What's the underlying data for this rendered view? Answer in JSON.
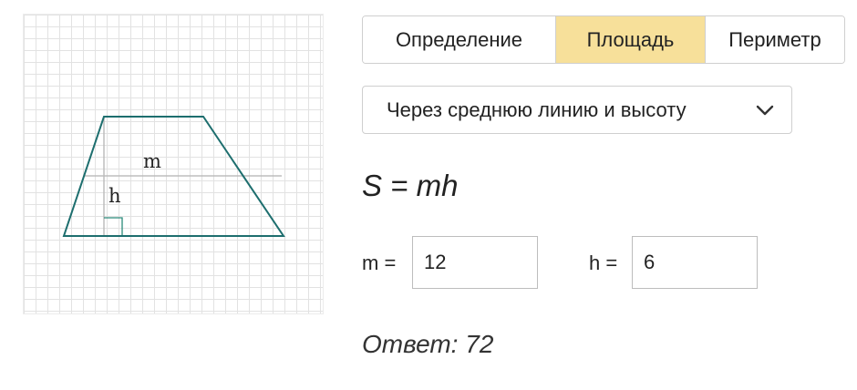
{
  "figure": {
    "midline_label": "m",
    "height_label": "h"
  },
  "tabs": [
    {
      "label": "Определение",
      "active": false
    },
    {
      "label": "Площадь",
      "active": true
    },
    {
      "label": "Периметр",
      "active": false
    }
  ],
  "method_select": {
    "selected": "Через среднюю линию и высоту",
    "icon": "chevron-down-icon"
  },
  "formula": "S = mh",
  "inputs": {
    "m": {
      "label": "m =",
      "value": "12"
    },
    "h": {
      "label": "h =",
      "value": "6"
    }
  },
  "answer": {
    "text": "Ответ: 72"
  },
  "colors": {
    "active_tab": "#f7e09a",
    "figure_stroke": "#1d6e6e"
  }
}
